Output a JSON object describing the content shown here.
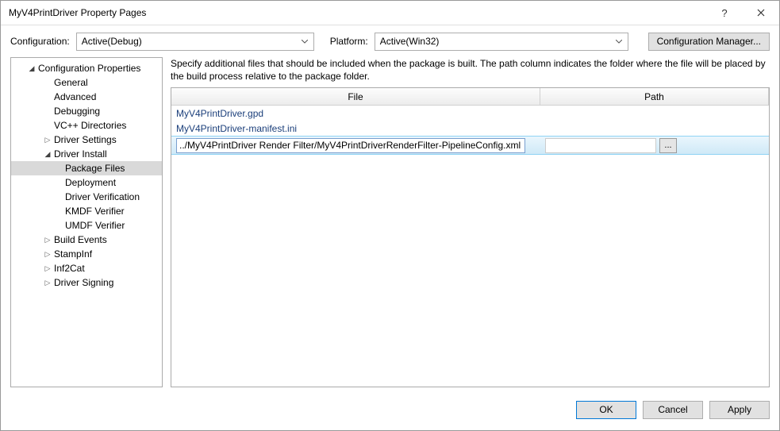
{
  "window": {
    "title": "MyV4PrintDriver Property Pages",
    "help_label": "?",
    "close_label": "✕"
  },
  "config": {
    "configuration_label": "Configuration:",
    "configuration_value": "Active(Debug)",
    "platform_label": "Platform:",
    "platform_value": "Active(Win32)",
    "manager_button": "Configuration Manager..."
  },
  "tree": [
    {
      "label": "Configuration Properties",
      "depth": 1,
      "arrow": "open"
    },
    {
      "label": "General",
      "depth": 2,
      "arrow": "none"
    },
    {
      "label": "Advanced",
      "depth": 2,
      "arrow": "none"
    },
    {
      "label": "Debugging",
      "depth": 2,
      "arrow": "none"
    },
    {
      "label": "VC++ Directories",
      "depth": 2,
      "arrow": "none"
    },
    {
      "label": "Driver Settings",
      "depth": 2,
      "arrow": "closed"
    },
    {
      "label": "Driver Install",
      "depth": 2,
      "arrow": "open"
    },
    {
      "label": "Package Files",
      "depth": 3,
      "arrow": "none",
      "selected": true
    },
    {
      "label": "Deployment",
      "depth": 3,
      "arrow": "none"
    },
    {
      "label": "Driver Verification",
      "depth": 3,
      "arrow": "none"
    },
    {
      "label": "KMDF Verifier",
      "depth": 3,
      "arrow": "none"
    },
    {
      "label": "UMDF Verifier",
      "depth": 3,
      "arrow": "none"
    },
    {
      "label": "Build Events",
      "depth": 2,
      "arrow": "closed"
    },
    {
      "label": "StampInf",
      "depth": 2,
      "arrow": "closed"
    },
    {
      "label": "Inf2Cat",
      "depth": 2,
      "arrow": "closed"
    },
    {
      "label": "Driver Signing",
      "depth": 2,
      "arrow": "closed"
    }
  ],
  "panel": {
    "description": "Specify additional files that should be included when the package is built.  The path column indicates the folder where the file will be placed by the build process relative to the package folder.",
    "col_file": "File",
    "col_path": "Path",
    "rows": [
      {
        "file": "MyV4PrintDriver.gpd",
        "path": ""
      },
      {
        "file": "MyV4PrintDriver-manifest.ini",
        "path": ""
      }
    ],
    "edit_row": {
      "file": "../MyV4PrintDriver Render Filter/MyV4PrintDriverRenderFilter-PipelineConfig.xml",
      "path": "",
      "browse": "..."
    }
  },
  "footer": {
    "ok": "OK",
    "cancel": "Cancel",
    "apply": "Apply"
  }
}
